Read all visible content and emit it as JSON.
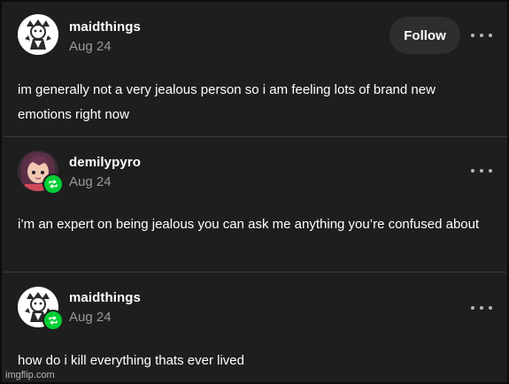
{
  "posts": [
    {
      "username": "maidthings",
      "date": "Aug 24",
      "avatar": "maid-avatar",
      "follow_label": "Follow",
      "reblogged": false,
      "text": "im generally not a very jealous person so i am feeling lots of brand new emotions right now"
    },
    {
      "username": "demilypyro",
      "date": "Aug 24",
      "avatar": "girl-avatar",
      "reblogged": true,
      "text": "i’m an expert on being jealous you can ask me anything you’re confused about"
    },
    {
      "username": "maidthings",
      "date": "Aug 24",
      "avatar": "maid-avatar",
      "reblogged": true,
      "text": "how do i kill everything thats ever lived"
    }
  ],
  "icons": {
    "more": "more-horizontal-icon",
    "reblog": "reblog-icon"
  },
  "colors": {
    "background": "#1e1e1e",
    "text": "#ffffff",
    "muted": "#9a9a9a",
    "reblog_badge": "#00cf35",
    "follow_button": "#2e2e2e"
  },
  "watermark": "imgflip.com"
}
